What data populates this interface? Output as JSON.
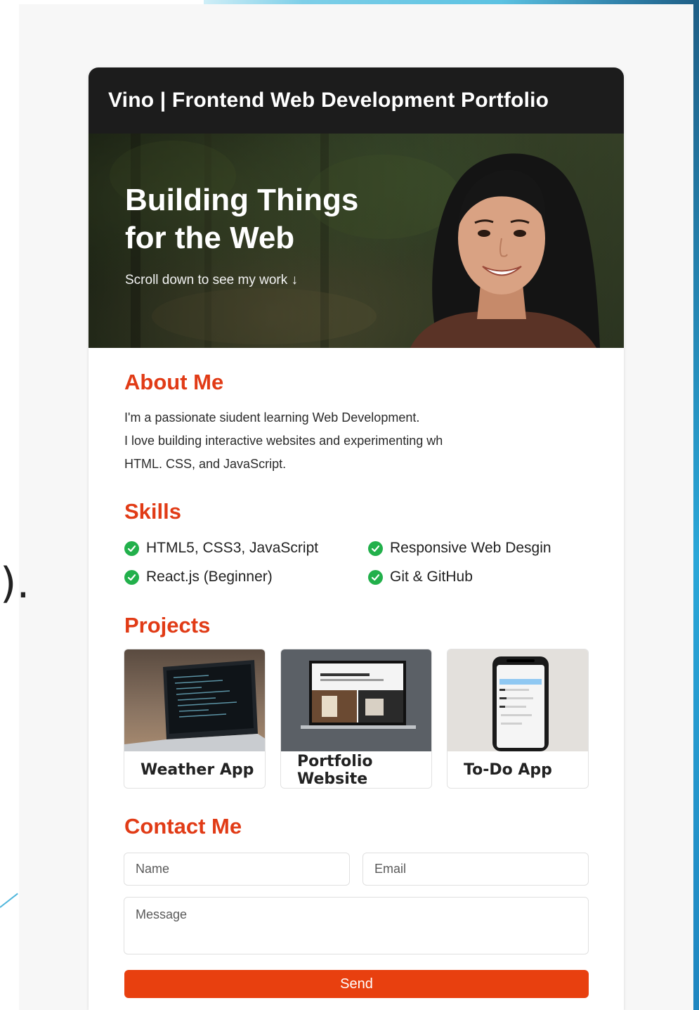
{
  "site": {
    "title": "Vino | Frontend Web Development Portfolio"
  },
  "hero": {
    "title_line1": "Building Things",
    "title_line2": "for the Web",
    "subtitle": "Scroll down to see my work ↓"
  },
  "about": {
    "heading": "About Me",
    "lines": [
      "I'm a passionate siudent learning Web Development.",
      "I love building interactive websites and experimenting wh",
      "HTML. CSS, and JavaScript."
    ]
  },
  "skills": {
    "heading": "Skills",
    "items": [
      "HTML5, CSS3, JavaScript",
      "Responsive Web Desgin",
      "React.js (Beginner)",
      "Git & GitHub"
    ]
  },
  "projects": {
    "heading": "Projects",
    "items": [
      {
        "name": "Weather App",
        "thumb_icon": "laptop-code-icon"
      },
      {
        "name": "Portfolio Website",
        "thumb_icon": "monitor-website-icon"
      },
      {
        "name": "To-Do App",
        "thumb_icon": "phone-app-icon"
      }
    ]
  },
  "contact": {
    "heading": "Contact Me",
    "name_placeholder": "Name",
    "email_placeholder": "Email",
    "message_placeholder": "Message",
    "send_label": "Send"
  },
  "colors": {
    "accent": "#e13b16",
    "button": "#e8400f",
    "check": "#22b04b",
    "topbar": "#1c1c1c"
  }
}
